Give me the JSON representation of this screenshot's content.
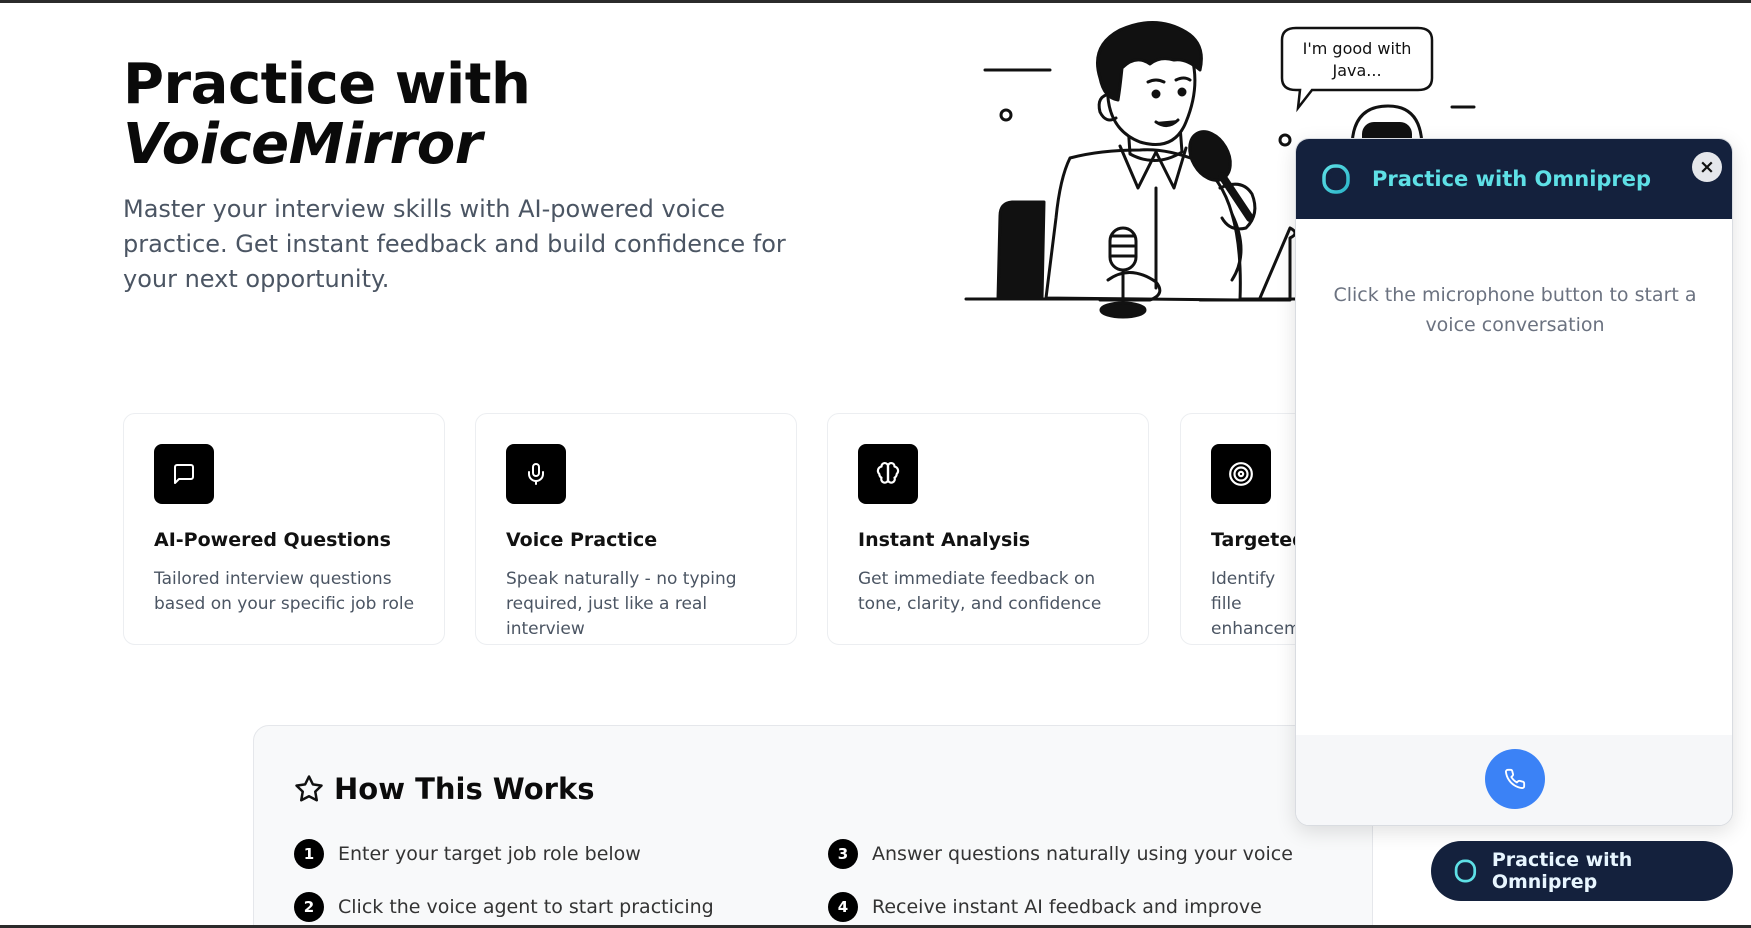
{
  "hero": {
    "title_line1": "Practice with",
    "title_line2": "VoiceMirror",
    "subtitle": "Master your interview skills with AI-powered voice practice. Get instant feedback and build confidence for your next opportunity."
  },
  "illustration": {
    "speech_bubble_line1": "I'm good with",
    "speech_bubble_line2": "Java..."
  },
  "features": [
    {
      "icon": "message-square-icon",
      "title": "AI-Powered Questions",
      "desc": "Tailored interview questions based on your specific job role"
    },
    {
      "icon": "microphone-icon",
      "title": "Voice Practice",
      "desc": "Speak naturally - no typing required, just like a real interview"
    },
    {
      "icon": "brain-icon",
      "title": "Instant Analysis",
      "desc": "Get immediate feedback on tone, clarity, and confidence"
    },
    {
      "icon": "target-icon",
      "title": "Targeted",
      "desc": "Identify fille enhanceme"
    }
  ],
  "how": {
    "title": "How This Works",
    "steps": [
      {
        "num": "1",
        "text": "Enter your target job role below"
      },
      {
        "num": "2",
        "text": "Click the voice agent to start practicing"
      },
      {
        "num": "3",
        "text": "Answer questions naturally using your voice"
      },
      {
        "num": "4",
        "text": "Receive instant AI feedback and improve"
      }
    ]
  },
  "widget": {
    "title": "Practice with Omniprep",
    "close_label": "×",
    "message": "Click the microphone button to start a voice conversation"
  },
  "launcher": {
    "label": "Practice with Omniprep"
  },
  "colors": {
    "widget_header": "#14213d",
    "widget_title": "#5ee0e6",
    "call_button": "#3b82f6",
    "icon_box": "#000000"
  }
}
